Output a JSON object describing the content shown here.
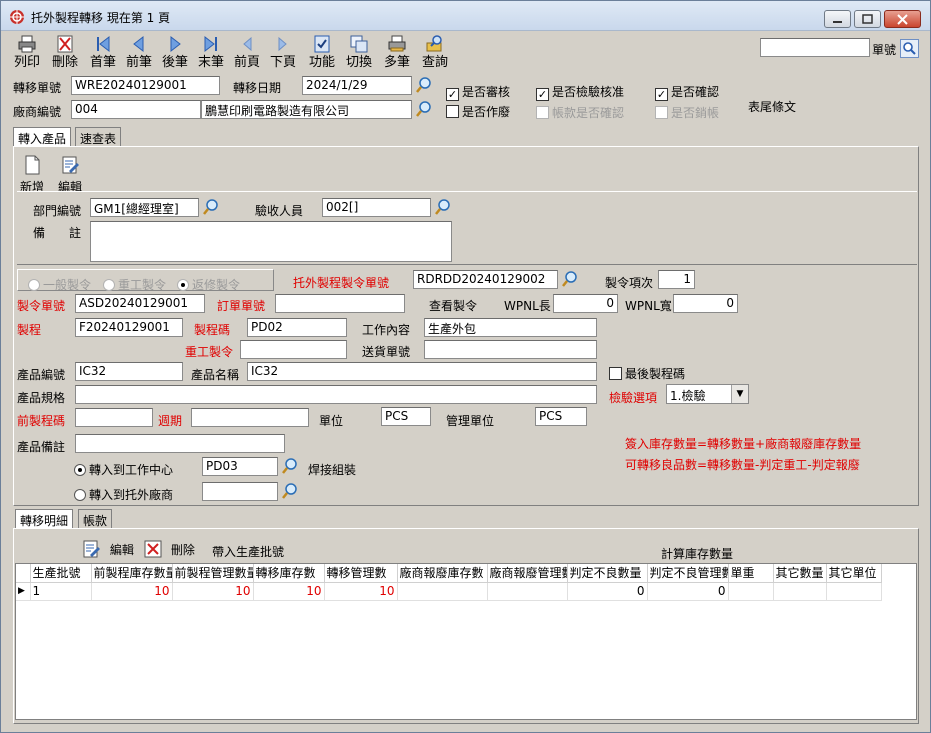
{
  "window": {
    "title": "托外製程轉移  現在第 1 頁"
  },
  "toolbar": {
    "buttons": [
      {
        "label": "列印",
        "icon": "printer-icon"
      },
      {
        "label": "刪除",
        "icon": "delete-icon"
      },
      {
        "label": "首筆",
        "icon": "first-record-icon"
      },
      {
        "label": "前筆",
        "icon": "prev-record-icon"
      },
      {
        "label": "後筆",
        "icon": "next-record-icon"
      },
      {
        "label": "末筆",
        "icon": "last-record-icon"
      },
      {
        "label": "前頁",
        "icon": "prev-page-icon"
      },
      {
        "label": "下頁",
        "icon": "next-page-icon"
      },
      {
        "label": "功能",
        "icon": "function-icon"
      },
      {
        "label": "切換",
        "icon": "switch-icon"
      },
      {
        "label": "多筆",
        "icon": "multi-record-icon"
      },
      {
        "label": "查詢",
        "icon": "query-icon"
      }
    ],
    "search_label": "單號",
    "search_value": ""
  },
  "header": {
    "transfer_no_label": "轉移單號",
    "transfer_no": "WRE20240129001",
    "transfer_date_label": "轉移日期",
    "transfer_date": "2024/1/29",
    "vendor_no_label": "廠商編號",
    "vendor_no": "004",
    "vendor_name": "鵬慧印刷電路製造有限公司",
    "chk_reviewed": "是否審核",
    "chk_inspection": "是否檢驗核准",
    "chk_confirmed": "是否確認",
    "chk_void": "是否作廢",
    "chk_account": "帳款是否確認",
    "chk_writeoff": "是否銷帳",
    "footer_text": "表尾條文"
  },
  "tabs": {
    "import_products": "轉入產品",
    "quick_table": "速查表"
  },
  "actions": {
    "add": "新增",
    "edit": "編輯"
  },
  "dept": {
    "dept_label": "部門編號",
    "dept_value": "GM1[總經理室]",
    "inspector_label": "驗收人員",
    "inspector_value": "002[]",
    "remark_label": "備　　註",
    "remark_value": ""
  },
  "order": {
    "radio_normal": "一般製令",
    "radio_rework": "重工製令",
    "radio_repair": "返修製令",
    "outsource_order_label": "托外製程製令單號",
    "outsource_order": "RDRDD20240129002",
    "order_item_label": "製令項次",
    "order_item": "1",
    "order_no_label": "製令單號",
    "order_no": "ASD20240129001",
    "purchase_no_label": "訂單單號",
    "purchase_no": "",
    "view_order_label": "查看製令",
    "wpnl_len_label": "WPNL長",
    "wpnl_len": "0",
    "wpnl_wid_label": "WPNL寬",
    "wpnl_wid": "0",
    "process_label": "製程",
    "process": "F20240129001",
    "process_code_label": "製程碼",
    "process_code": "PD02",
    "work_content_label": "工作內容",
    "work_content": "生產外包",
    "rework_label": "重工製令",
    "rework": "",
    "delivery_no_label": "送貨單號",
    "delivery_no": "",
    "product_no_label": "產品編號",
    "product_no": "IC32",
    "product_name_label": "產品名稱",
    "product_name": "IC32",
    "last_process_label": "最後製程碼",
    "spec_label": "產品規格",
    "spec": "",
    "inspect_option_label": "檢驗選項",
    "inspect_option": "1.檢驗",
    "prev_process_label": "前製程碼",
    "prev_process": "",
    "cycle_label": "週期",
    "cycle": "",
    "unit_label": "單位",
    "unit": "PCS",
    "mgmt_unit_label": "管理單位",
    "mgmt_unit": "PCS",
    "product_remark_label": "產品備註",
    "product_remark": "",
    "formula1": "簽入庫存數量=轉移數量+廠商報廢庫存數量",
    "formula2": "可轉移良品數=轉移數量-判定重工-判定報廢",
    "to_workcenter_label": "轉入到工作中心",
    "to_workcenter": "PD03",
    "workcenter_name": "焊接組裝",
    "to_vendor_label": "轉入到托外廠商",
    "to_vendor": ""
  },
  "detail_tabs": {
    "transfer_detail": "轉移明細",
    "account": "帳款"
  },
  "detail_actions": {
    "edit": "編輯",
    "delete": "刪除",
    "bring_batch": "帶入生產批號",
    "calc_stock": "計算庫存數量"
  },
  "grid": {
    "columns": [
      "生產批號",
      "前製程庫存數量",
      "前製程管理數量",
      "轉移庫存數",
      "轉移管理數",
      "廠商報廢庫存數",
      "廠商報廢管理數",
      "判定不良數量",
      "判定不良管理數",
      "單重",
      "其它數量",
      "其它單位"
    ],
    "rows": [
      [
        "1",
        "10",
        "10",
        "10",
        "10",
        "",
        "",
        "0",
        "0",
        "",
        "",
        ""
      ]
    ]
  }
}
